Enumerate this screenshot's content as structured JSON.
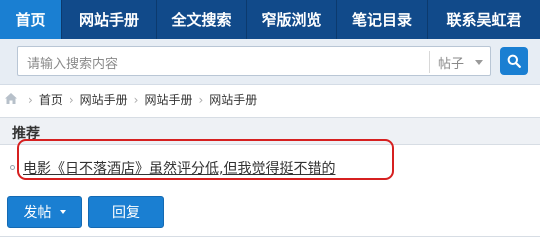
{
  "topnav": {
    "items": [
      {
        "label": "首页",
        "active": true
      },
      {
        "label": "网站手册",
        "active": false
      },
      {
        "label": "全文搜索",
        "active": false
      },
      {
        "label": "窄版浏览",
        "active": false
      },
      {
        "label": "笔记目录",
        "active": false
      },
      {
        "label": "联系吴虹君",
        "active": false
      }
    ]
  },
  "search": {
    "placeholder": "请输入搜索内容",
    "type_label": "帖子",
    "button_icon": "search-icon"
  },
  "breadcrumb": {
    "home_icon": "home-icon",
    "items": [
      "首页",
      "网站手册",
      "网站手册",
      "网站手册"
    ]
  },
  "section": {
    "title": "推荐"
  },
  "recommended": {
    "items": [
      {
        "title": "电影《日不落酒店》虽然评分低,但我觉得挺不错的"
      }
    ]
  },
  "actions": {
    "post_label": "发帖",
    "reply_label": "回复"
  },
  "colors": {
    "nav_bg": "#114a8a",
    "nav_active": "#1a7fd2",
    "button_blue": "#1a7fd2",
    "highlight_red": "#d62020"
  }
}
